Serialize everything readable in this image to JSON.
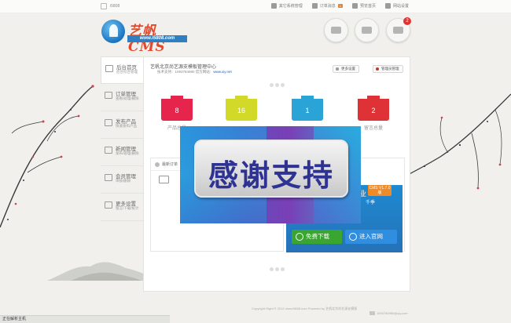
{
  "topbar": {
    "site": "i5808",
    "links": [
      {
        "label": "其它系统管理"
      },
      {
        "label": "订单消息",
        "badge": "1"
      },
      {
        "label": "预览首页"
      },
      {
        "label": "网站设置"
      }
    ]
  },
  "logo": {
    "name": "艺帆CMS",
    "url": "www.i5808.com"
  },
  "header_buttons": [
    {
      "icon": "user-icon"
    },
    {
      "icon": "truck-icon"
    },
    {
      "icon": "chat-icon",
      "notification": "2"
    }
  ],
  "sidebar": {
    "items": [
      {
        "title": "后台首页",
        "sub": "后台综合管理",
        "active": true
      },
      {
        "title": "订单管理",
        "sub": "查看/处理/删除"
      },
      {
        "title": "发布产品",
        "sub": "快速发布产品"
      },
      {
        "title": "新闻管理",
        "sub": "发布/管理/删除"
      },
      {
        "title": "会员管理",
        "sub": "审核/删除"
      },
      {
        "title": "更多设置",
        "sub": "留言/下载/统计"
      }
    ]
  },
  "welcome": {
    "line1": "艺帆北京尚艺源支模板管理中心",
    "support": "技术支持：1093784980 官方网站：",
    "site": "www.xiy.net",
    "more_settings": "更多设置",
    "admin": "管理员管理"
  },
  "stats": [
    {
      "value": "8",
      "label": "产品总量",
      "color": "#e5254b"
    },
    {
      "value": "16",
      "label": "",
      "color": "#d2d928"
    },
    {
      "value": "1",
      "label": "",
      "color": "#2aa3d6"
    },
    {
      "value": "2",
      "label": "留言总量",
      "color": "#df3237"
    }
  ],
  "orders_panel": {
    "title": "最新订单"
  },
  "ad": {
    "version": "CMS V1.7.0版",
    "tag": "千季",
    "download": "免费下载",
    "official": "进入官网"
  },
  "overlay": {
    "text": "感谢支持"
  },
  "footer": {
    "line1": "Copyright Right © 2012 www.i5808.com Powered by 艺帆北京尚艺源支模版",
    "line2": "1093784980@qq.com"
  },
  "statusbar": {
    "text": "正在解析主机"
  }
}
